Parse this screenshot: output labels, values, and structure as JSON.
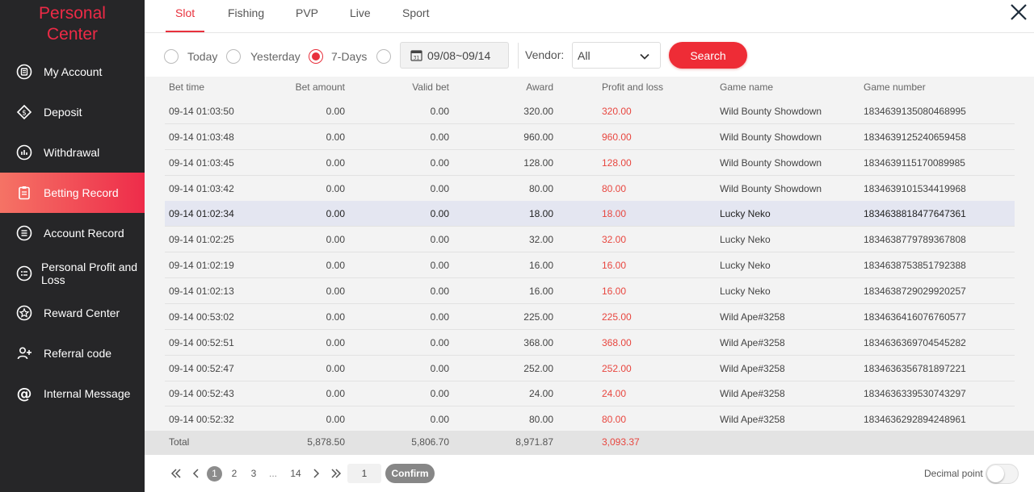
{
  "sidebar": {
    "title_line1": "Personal",
    "title_line2": "Center",
    "items": [
      {
        "label": "My Account",
        "icon": "account-icon"
      },
      {
        "label": "Deposit",
        "icon": "deposit-icon"
      },
      {
        "label": "Withdrawal",
        "icon": "withdrawal-icon"
      },
      {
        "label": "Betting Record",
        "icon": "clipboard-icon",
        "active": true
      },
      {
        "label": "Account Record",
        "icon": "list-icon"
      },
      {
        "label": "Personal Profit and Loss",
        "icon": "profit-icon"
      },
      {
        "label": "Reward Center",
        "icon": "star-icon"
      },
      {
        "label": "Referral code",
        "icon": "add-user-icon"
      },
      {
        "label": "Internal Message",
        "icon": "at-icon"
      }
    ]
  },
  "tabs": [
    "Slot",
    "Fishing",
    "PVP",
    "Live",
    "Sport"
  ],
  "filter": {
    "today": "Today",
    "yesterday": "Yesterday",
    "seven_days": "7-Days",
    "date_range": "09/08~09/14",
    "vendor_label": "Vendor:",
    "vendor_value": "All",
    "search": "Search"
  },
  "table": {
    "headers": [
      "Bet time",
      "Bet amount",
      "Valid bet",
      "Award",
      "Profit and loss",
      "Game name",
      "Game number"
    ],
    "rows": [
      [
        "09-14 01:03:50",
        "0.00",
        "0.00",
        "320.00",
        "320.00",
        "Wild Bounty Showdown",
        "1834639135080468995"
      ],
      [
        "09-14 01:03:48",
        "0.00",
        "0.00",
        "960.00",
        "960.00",
        "Wild Bounty Showdown",
        "1834639125240659458"
      ],
      [
        "09-14 01:03:45",
        "0.00",
        "0.00",
        "128.00",
        "128.00",
        "Wild Bounty Showdown",
        "1834639115170089985"
      ],
      [
        "09-14 01:03:42",
        "0.00",
        "0.00",
        "80.00",
        "80.00",
        "Wild Bounty Showdown",
        "1834639101534419968"
      ],
      [
        "09-14 01:02:34",
        "0.00",
        "0.00",
        "18.00",
        "18.00",
        "Lucky Neko",
        "1834638818477647361"
      ],
      [
        "09-14 01:02:25",
        "0.00",
        "0.00",
        "32.00",
        "32.00",
        "Lucky Neko",
        "1834638779789367808"
      ],
      [
        "09-14 01:02:19",
        "0.00",
        "0.00",
        "16.00",
        "16.00",
        "Lucky Neko",
        "1834638753851792388"
      ],
      [
        "09-14 01:02:13",
        "0.00",
        "0.00",
        "16.00",
        "16.00",
        "Lucky Neko",
        "1834638729029920257"
      ],
      [
        "09-14 00:53:02",
        "0.00",
        "0.00",
        "225.00",
        "225.00",
        "Wild Ape#3258",
        "1834636416076760577"
      ],
      [
        "09-14 00:52:51",
        "0.00",
        "0.00",
        "368.00",
        "368.00",
        "Wild Ape#3258",
        "1834636369704545282"
      ],
      [
        "09-14 00:52:47",
        "0.00",
        "0.00",
        "252.00",
        "252.00",
        "Wild Ape#3258",
        "1834636356781897221"
      ],
      [
        "09-14 00:52:43",
        "0.00",
        "0.00",
        "24.00",
        "24.00",
        "Wild Ape#3258",
        "1834636339530743297"
      ],
      [
        "09-14 00:52:32",
        "0.00",
        "0.00",
        "80.00",
        "80.00",
        "Wild Ape#3258",
        "1834636292894248961"
      ]
    ],
    "total": {
      "label": "Total",
      "bet_amount": "5,878.50",
      "valid_bet": "5,806.70",
      "award": "8,971.87",
      "profit_loss": "3,093.37"
    }
  },
  "pager": {
    "pages": [
      "1",
      "2",
      "3",
      "...",
      "14"
    ],
    "current": "1",
    "input_value": "1",
    "confirm": "Confirm",
    "decimal_label": "Decimal point"
  },
  "colors": {
    "accent": "#e8313d",
    "sidebar_bg": "#262628",
    "profit_red": "#e8463f"
  }
}
